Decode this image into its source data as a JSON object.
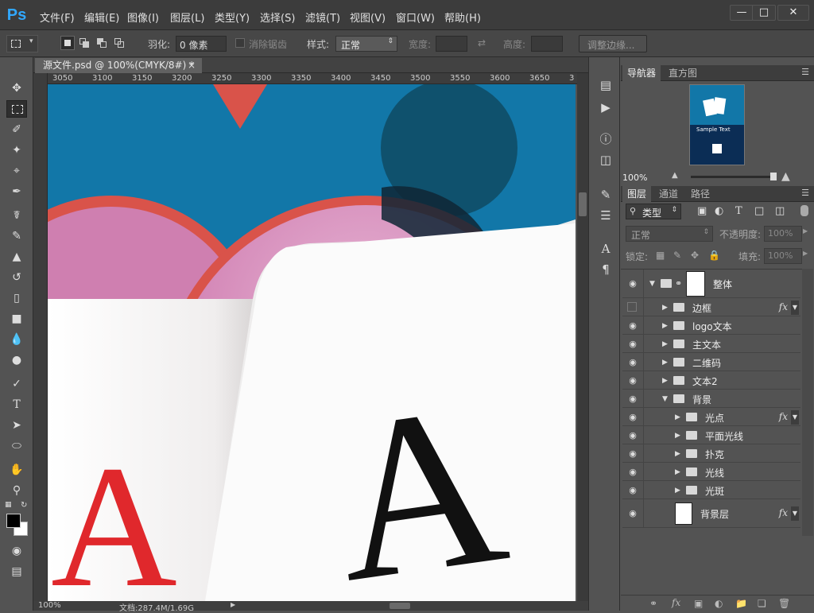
{
  "app": {
    "logo": "Ps"
  },
  "menu": [
    "文件(F)",
    "编辑(E)",
    "图像(I)",
    "图层(L)",
    "类型(Y)",
    "选择(S)",
    "滤镜(T)",
    "视图(V)",
    "窗口(W)",
    "帮助(H)"
  ],
  "options": {
    "feather_label": "羽化:",
    "feather_value": "0 像素",
    "antialias_label": "消除锯齿",
    "style_label": "样式:",
    "style_value": "正常",
    "width_label": "宽度:",
    "height_label": "高度:",
    "refine_label": "调整边缘..."
  },
  "document": {
    "tab_title": "源文件.psd @ 100%(CMYK/8#) *",
    "ruler_ticks": [
      "3050",
      "3100",
      "3150",
      "3200",
      "3250",
      "3300",
      "3350",
      "3400",
      "3450",
      "3500",
      "3550",
      "3600",
      "3650",
      "3"
    ],
    "zoom": "100%",
    "doc_info": "文档:287.4M/1.69G",
    "card_letter": "A"
  },
  "navigator": {
    "tabs": [
      "导航器",
      "直方图"
    ],
    "zoom": "100%",
    "thumb_title": "Sample Text"
  },
  "layers_panel": {
    "tabs": [
      "图层",
      "通道",
      "路径"
    ],
    "filter_label": "类型",
    "blend_mode": "正常",
    "opacity_label": "不透明度:",
    "opacity_value": "100%",
    "lock_label": "锁定:",
    "fill_label": "填充:",
    "fill_value": "100%",
    "layers": [
      {
        "name": "整体",
        "type": "group-open",
        "visible": true,
        "indent": 0,
        "fx": false
      },
      {
        "name": "边框",
        "type": "group",
        "visible": false,
        "indent": 1,
        "fx": true
      },
      {
        "name": "logo文本",
        "type": "group",
        "visible": true,
        "indent": 1,
        "fx": false
      },
      {
        "name": "主文本",
        "type": "group",
        "visible": true,
        "indent": 1,
        "fx": false
      },
      {
        "name": "二维码",
        "type": "group",
        "visible": true,
        "indent": 1,
        "fx": false
      },
      {
        "name": "文本2",
        "type": "group",
        "visible": true,
        "indent": 1,
        "fx": false
      },
      {
        "name": "背景",
        "type": "group-open",
        "visible": true,
        "indent": 1,
        "fx": false
      },
      {
        "name": "光点",
        "type": "group",
        "visible": true,
        "indent": 2,
        "fx": true
      },
      {
        "name": "平面光线",
        "type": "group",
        "visible": true,
        "indent": 2,
        "fx": false
      },
      {
        "name": "扑克",
        "type": "group",
        "visible": true,
        "indent": 2,
        "fx": false
      },
      {
        "name": "光线",
        "type": "group",
        "visible": true,
        "indent": 2,
        "fx": false
      },
      {
        "name": "光斑",
        "type": "group",
        "visible": true,
        "indent": 2,
        "fx": false
      },
      {
        "name": "背景层",
        "type": "layer",
        "visible": true,
        "indent": 0,
        "fx": true
      }
    ]
  },
  "colors": {
    "canvas_blue": "#1277a8",
    "card_red": "#e0282c",
    "accent_pink": "#cf7fb0"
  }
}
